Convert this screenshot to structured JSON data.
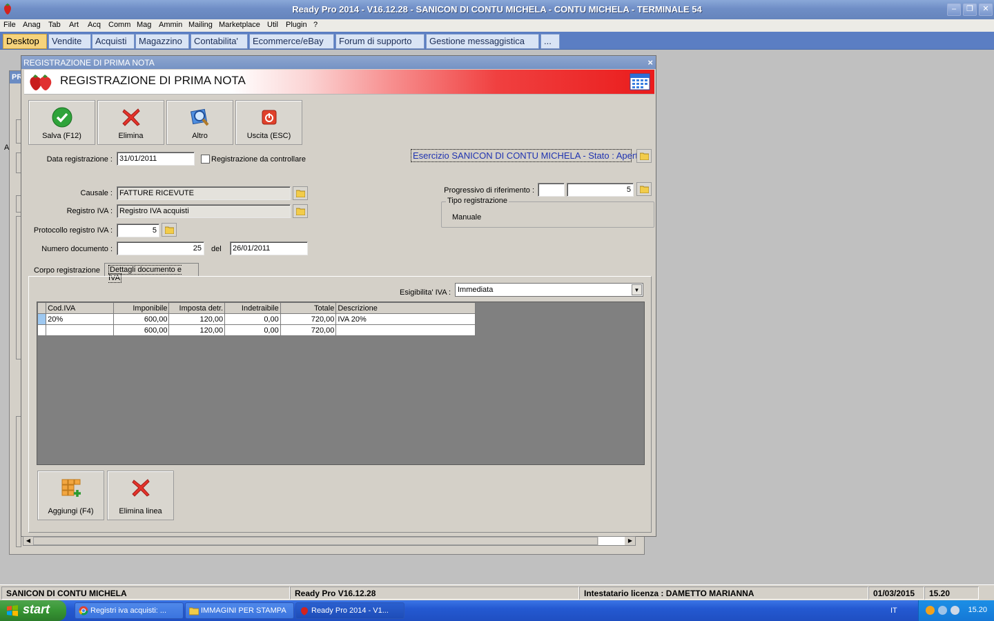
{
  "window": {
    "title": "Ready Pro 2014 - V16.12.28 - SANICON DI CONTU MICHELA - CONTU MICHELA - TERMINALE 54"
  },
  "menu": [
    "File",
    "Anag",
    "Tab",
    "Art",
    "Acq",
    "Comm",
    "Mag",
    "Ammin",
    "Mailing",
    "Marketplace",
    "Util",
    "Plugin",
    "?"
  ],
  "tabs": [
    "Desktop",
    "Vendite",
    "Acquisti",
    "Magazzino",
    "Contabilita'",
    "Ecommerce/eBay",
    "Forum di supporto",
    "Gestione messaggistica",
    "..."
  ],
  "background_window": {
    "title_fragment": "PR",
    "side_fragment": "A"
  },
  "dialog": {
    "window_title": "REGISTRAZIONE DI PRIMA NOTA",
    "banner_title": "REGISTRAZIONE DI PRIMA NOTA",
    "toolbar": {
      "save": "Salva (F12)",
      "delete": "Elimina",
      "other": "Altro",
      "exit": "Uscita (ESC)"
    },
    "form": {
      "data_registrazione_label": "Data registrazione :",
      "data_registrazione": "31/01/2011",
      "da_controllare_label": "Registrazione da controllare",
      "da_controllare_checked": false,
      "esercizio": "Esercizio SANICON DI CONTU MICHELA - Stato : Aperto",
      "causale_label": "Causale :",
      "causale": "FATTURE RICEVUTE",
      "registro_iva_label": "Registro IVA :",
      "registro_iva": "Registro IVA acquisti",
      "protocollo_label": "Protocollo registro IVA :",
      "protocollo": "5",
      "numero_documento_label": "Numero documento :",
      "numero_documento": "25",
      "del_label": "del",
      "data_documento": "26/01/2011",
      "progressivo_label": "Progressivo di riferimento :",
      "progressivo_prefix": "",
      "progressivo": "5",
      "tipo_registrazione_label": "Tipo registrazione",
      "tipo_registrazione": "Manuale"
    },
    "inner_tabs": {
      "corpo": "Corpo registrazione",
      "dettagli": "Dettagli documento e IVA"
    },
    "esigibilita_label": "Esigibilita' IVA :",
    "esigibilita": "Immediata",
    "grid": {
      "columns": [
        "Cod.IVA",
        "Imponibile",
        "Imposta detr.",
        "Indetraibile",
        "Totale",
        "Descrizione"
      ],
      "rows": [
        [
          "20%",
          "600,00",
          "120,00",
          "0,00",
          "720,00",
          "IVA 20%"
        ],
        [
          "",
          "600,00",
          "120,00",
          "0,00",
          "720,00",
          ""
        ]
      ]
    },
    "bottom_buttons": {
      "add": "Aggiungi (F4)",
      "delete_line": "Elimina linea"
    }
  },
  "statusbar": {
    "company": "SANICON DI CONTU MICHELA",
    "version": "Ready Pro V16.12.28",
    "license": "Intestatario licenza : DAMETTO MARIANNA",
    "date": "01/03/2015",
    "time": "15.20"
  },
  "taskbar": {
    "start": "start",
    "tasks": [
      "Registri iva acquisti: ...",
      "IMMAGINI PER STAMPA",
      "Ready Pro 2014 - V1..."
    ],
    "language": "IT",
    "clock": "15.20"
  },
  "colors": {
    "title_blue": "#7592c4",
    "active_tab": "#f6d37b",
    "banner_red": "#ea1c1c",
    "grid_area": "#808080",
    "taskbar_blue": "#2459d1",
    "start_green": "#379534",
    "esercizio_text": "#1f33b0"
  },
  "icons": [
    "strawberry-icon",
    "calendar-icon",
    "check-icon",
    "red-x-icon",
    "magnifier-icon",
    "power-icon",
    "folder-icon",
    "grid-add-icon",
    "chrome-icon",
    "folder-icon",
    "windows-flag-icon"
  ]
}
